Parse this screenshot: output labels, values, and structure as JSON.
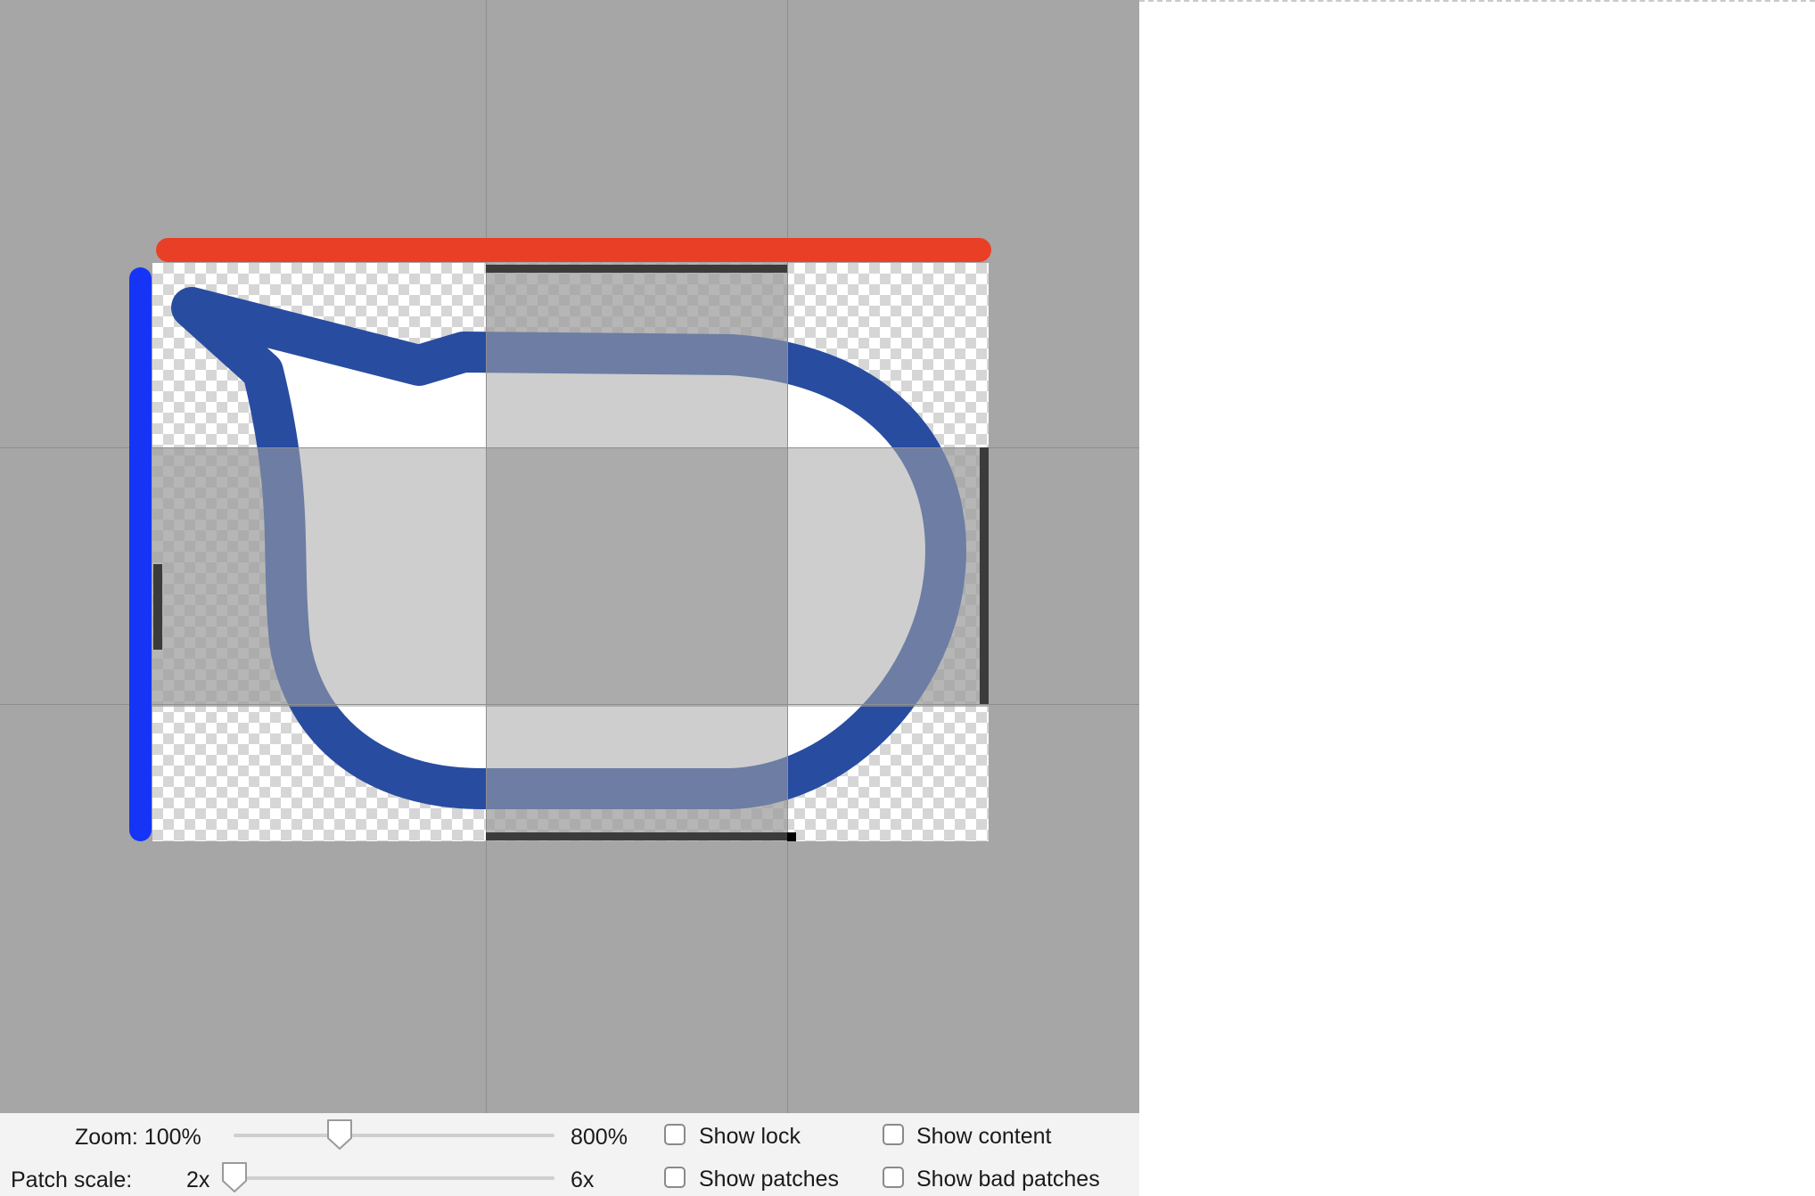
{
  "controls": {
    "zoom_label": "Zoom: 100%",
    "zoom_max": "800%",
    "zoom_level_fraction": 0.33,
    "patch_scale_label": "Patch scale:",
    "patch_scale_min": "2x",
    "patch_scale_max": "6x",
    "patch_scale_fraction": 0.0,
    "checkboxes": [
      {
        "label": "Show lock",
        "checked": false
      },
      {
        "label": "Show content",
        "checked": false
      },
      {
        "label": "Show patches",
        "checked": false
      },
      {
        "label": "Show bad patches",
        "checked": false
      }
    ]
  },
  "colors": {
    "canvas_bg": "#a6a6a6",
    "top_stretch_marker": "#ea3f27",
    "left_stretch_marker": "#1634f5",
    "shape_stroke": "#284ca0",
    "patch_overlay": "#a6a6a6"
  },
  "icons": [
    "speech-bubble-icon",
    "slider-thumb-icon",
    "checkbox-icon"
  ]
}
